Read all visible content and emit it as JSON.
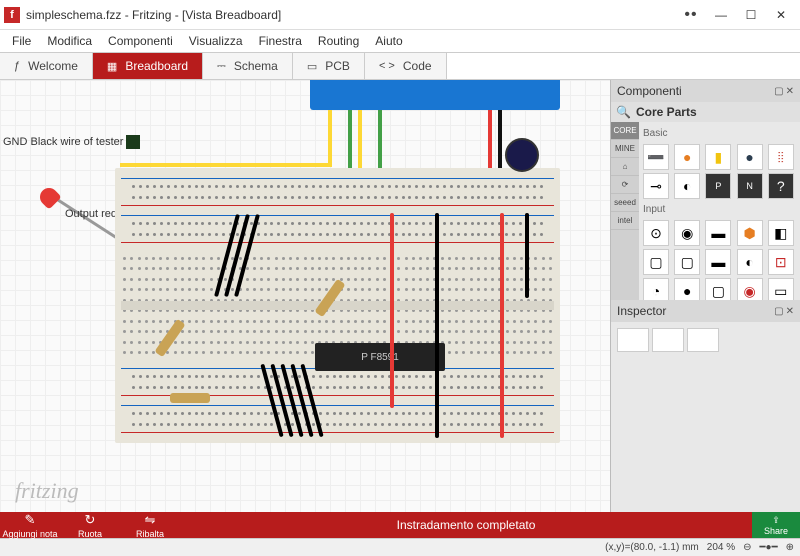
{
  "window": {
    "title": "simpleschema.fzz - Fritzing - [Vista Breadboard]",
    "controls": {
      "extra": "••",
      "min": "—",
      "max": "☐",
      "close": "✕"
    }
  },
  "menu": [
    "File",
    "Modifica",
    "Componenti",
    "Visualizza",
    "Finestra",
    "Routing",
    "Aiuto"
  ],
  "tabs": [
    {
      "icon": "ƒ",
      "label": "Welcome"
    },
    {
      "icon": "▦",
      "label": "Breadboard",
      "active": true
    },
    {
      "icon": "⎓",
      "label": "Schema"
    },
    {
      "icon": "▭",
      "label": "PCB"
    },
    {
      "icon": "< >",
      "label": "Code"
    }
  ],
  "canvas": {
    "note_gnd": "GND Black wire of tester",
    "note_out": "Output red wire of tester",
    "chip_label": "P F8591",
    "watermark": "fritzing"
  },
  "components_panel": {
    "title": "Componenti",
    "selected_group": "Core Parts",
    "categories": [
      "CORE",
      "MINE",
      "⌂",
      "⟳",
      "seeed",
      "intel"
    ],
    "sections": {
      "basic": "Basic",
      "input": "Input"
    }
  },
  "inspector_panel": {
    "title": "Inspector"
  },
  "bottom": {
    "add_note": "Aggiungi nota",
    "rotate": "Ruota",
    "flip": "Ribalta",
    "status": "Instradamento completato",
    "share": "Share"
  },
  "statusbar": {
    "coords": "(x,y)=(80.0, -1.1) mm",
    "zoom": "204 %"
  }
}
